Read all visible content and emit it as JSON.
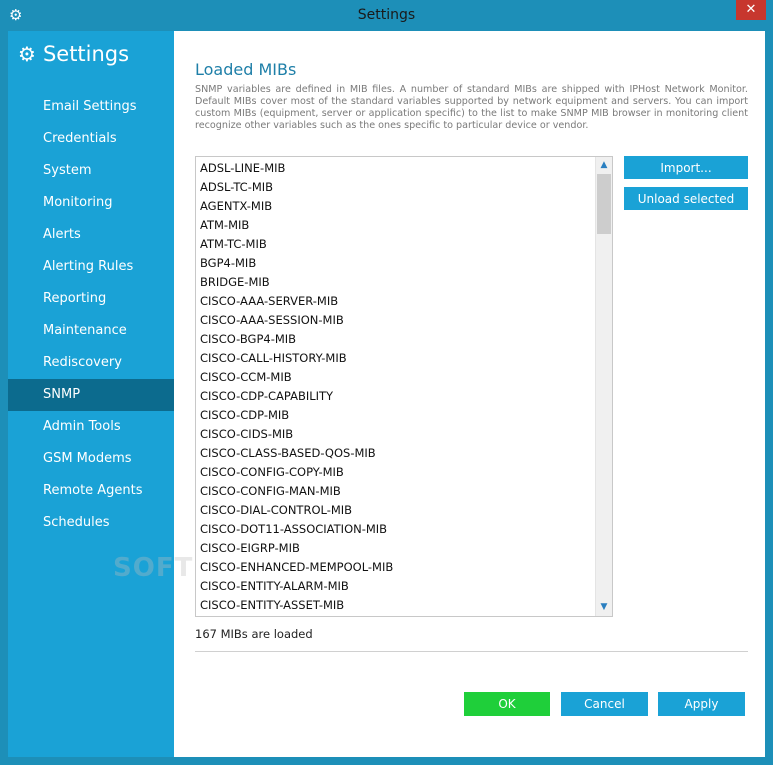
{
  "window": {
    "title": "Settings",
    "close_label": "✕"
  },
  "sidebar": {
    "title": "Settings",
    "items": [
      {
        "label": "Email Settings"
      },
      {
        "label": "Credentials"
      },
      {
        "label": "System"
      },
      {
        "label": "Monitoring"
      },
      {
        "label": "Alerts"
      },
      {
        "label": "Alerting Rules"
      },
      {
        "label": "Reporting"
      },
      {
        "label": "Maintenance"
      },
      {
        "label": "Rediscovery"
      },
      {
        "label": "SNMP",
        "active": true
      },
      {
        "label": "Admin Tools"
      },
      {
        "label": "GSM Modems"
      },
      {
        "label": "Remote Agents"
      },
      {
        "label": "Schedules"
      }
    ]
  },
  "main": {
    "section_title": "Loaded MIBs",
    "description": "SNMP variables are defined in MIB files. A number of standard MIBs are shipped with IPHost Network Monitor. Default MIBs cover most of the standard variables supported by network equipment and servers. You can import custom MIBs (equipment, server or application specific) to the list to make SNMP MIB browser in monitoring client recognize other variables such as the ones specific to particular device or vendor.",
    "mibs": [
      "ADSL-LINE-MIB",
      "ADSL-TC-MIB",
      "AGENTX-MIB",
      "ATM-MIB",
      "ATM-TC-MIB",
      "BGP4-MIB",
      "BRIDGE-MIB",
      "CISCO-AAA-SERVER-MIB",
      "CISCO-AAA-SESSION-MIB",
      "CISCO-BGP4-MIB",
      "CISCO-CALL-HISTORY-MIB",
      "CISCO-CCM-MIB",
      "CISCO-CDP-CAPABILITY",
      "CISCO-CDP-MIB",
      "CISCO-CIDS-MIB",
      "CISCO-CLASS-BASED-QOS-MIB",
      "CISCO-CONFIG-COPY-MIB",
      "CISCO-CONFIG-MAN-MIB",
      "CISCO-DIAL-CONTROL-MIB",
      "CISCO-DOT11-ASSOCIATION-MIB",
      "CISCO-EIGRP-MIB",
      "CISCO-ENHANCED-MEMPOOL-MIB",
      "CISCO-ENTITY-ALARM-MIB",
      "CISCO-ENTITY-ASSET-MIB"
    ],
    "import_label": "Import...",
    "unload_label": "Unload selected",
    "status": "167 MIBs are loaded",
    "scroll_up": "▲",
    "scroll_down": "▼"
  },
  "footer": {
    "ok_label": "OK",
    "cancel_label": "Cancel",
    "apply_label": "Apply"
  },
  "watermark": "SOFT"
}
